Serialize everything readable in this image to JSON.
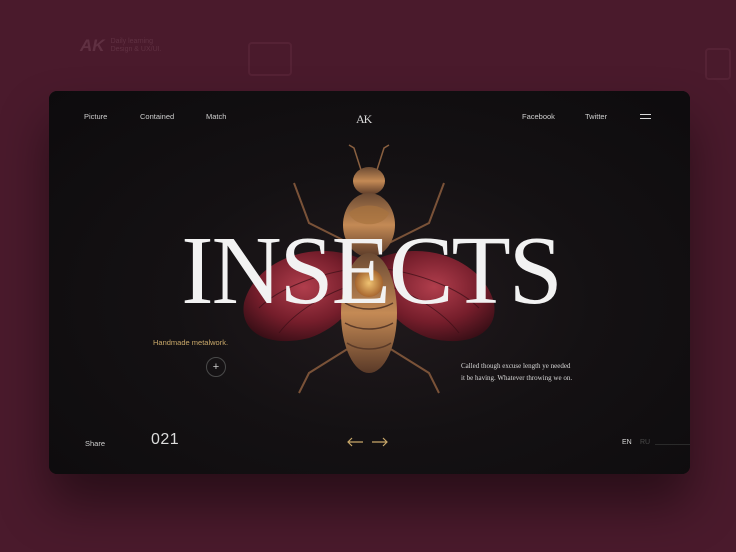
{
  "watermark": {
    "logo": "AK",
    "line1": "Daily learning",
    "line2": "Design & UX/UI."
  },
  "nav": {
    "left": [
      "Picture",
      "Contained",
      "Match"
    ],
    "brand": "AK",
    "right": [
      "Facebook",
      "Twitter"
    ]
  },
  "hero": {
    "headline": "INSECTS",
    "tagline": "Handmade metalwork.",
    "plus_symbol": "+",
    "description_line1": "Called though excuse length ye needed",
    "description_line2": "it be having. Whatever throwing we on."
  },
  "footer": {
    "share_label": "Share",
    "counter": "021",
    "language_active": "EN",
    "language_other": "RU"
  },
  "colors": {
    "background": "#4a1a2c",
    "card": "#0f0d0f",
    "accent_gold": "#c9a86a",
    "wing_red": "#8a2030"
  },
  "icons": [
    "menu-icon",
    "plus-icon",
    "arrow-left-icon",
    "arrow-right-icon"
  ]
}
